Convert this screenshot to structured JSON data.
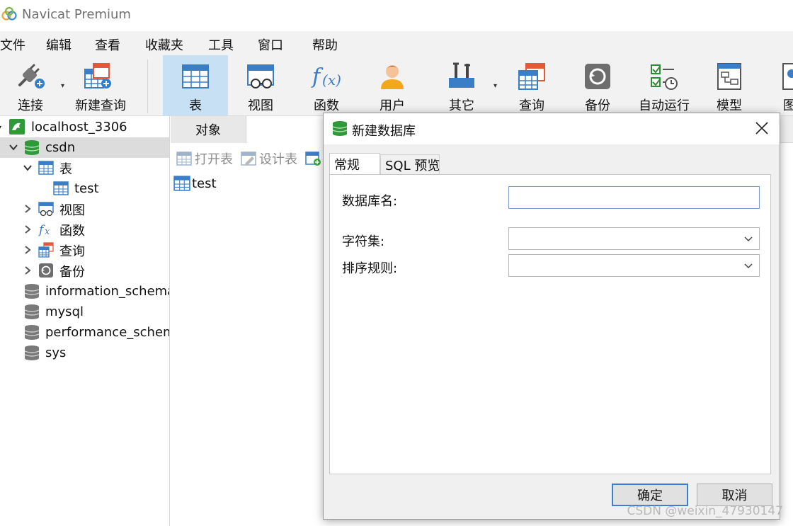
{
  "app": {
    "title": "Navicat Premium"
  },
  "menu": [
    "文件",
    "编辑",
    "查看",
    "收藏夹",
    "工具",
    "窗口",
    "帮助"
  ],
  "toolbar": {
    "connect": "连接",
    "new_query": "新建查询",
    "table": "表",
    "view": "视图",
    "function": "函数",
    "user": "用户",
    "other": "其它",
    "query": "查询",
    "backup": "备份",
    "auto_run": "自动运行",
    "model": "模型",
    "chart": "图"
  },
  "tree": {
    "connection": "localhost_3306",
    "db_csdn": "csdn",
    "tables": "表",
    "table_test": "test",
    "views": "视图",
    "functions": "函数",
    "queries": "查询",
    "backups": "备份",
    "db_information_schema": "information_schema",
    "db_mysql": "mysql",
    "db_performance_schema": "performance_schema",
    "db_sys": "sys"
  },
  "main": {
    "tab_objects": "对象",
    "open_table": "打开表",
    "design_table": "设计表",
    "object_test": "test"
  },
  "dialog": {
    "title": "新建数据库",
    "tab_general": "常规",
    "tab_sql_preview": "SQL 预览",
    "db_name_label": "数据库名:",
    "db_name_value": "",
    "charset_label": "字符集:",
    "charset_value": "",
    "collation_label": "排序规则:",
    "collation_value": "",
    "ok": "确定",
    "cancel": "取消"
  },
  "watermark": "CSDN @weixin_47930147"
}
